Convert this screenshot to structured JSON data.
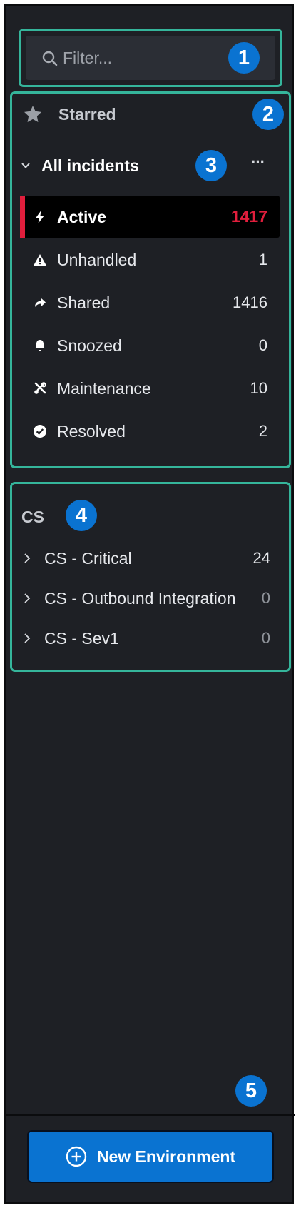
{
  "search": {
    "placeholder": "Filter..."
  },
  "starred": {
    "label": "Starred"
  },
  "all_incidents": {
    "label": "All incidents",
    "more_label": "···",
    "items": [
      {
        "label": "Active",
        "count": "1417",
        "icon": "bolt-icon"
      },
      {
        "label": "Unhandled",
        "count": "1",
        "icon": "warning-icon"
      },
      {
        "label": "Shared",
        "count": "1416",
        "icon": "share-arrow-icon"
      },
      {
        "label": "Snoozed",
        "count": "0",
        "icon": "bell-icon"
      },
      {
        "label": "Maintenance",
        "count": "10",
        "icon": "tools-icon"
      },
      {
        "label": "Resolved",
        "count": "2",
        "icon": "check-circle-icon"
      }
    ]
  },
  "cs_group": {
    "title": "CS",
    "items": [
      {
        "label": "CS - Critical",
        "count": "24"
      },
      {
        "label": "CS - Outbound Integration",
        "count": "0"
      },
      {
        "label": "CS - Sev1",
        "count": "0"
      }
    ]
  },
  "footer": {
    "new_environment_label": "New Environment"
  },
  "annotations": [
    "1",
    "2",
    "3",
    "4",
    "5"
  ],
  "colors": {
    "accent": "#0a73d1",
    "active_count": "#e01e3c",
    "callout": "#35b59b",
    "panel_bg": "#1e2025"
  }
}
